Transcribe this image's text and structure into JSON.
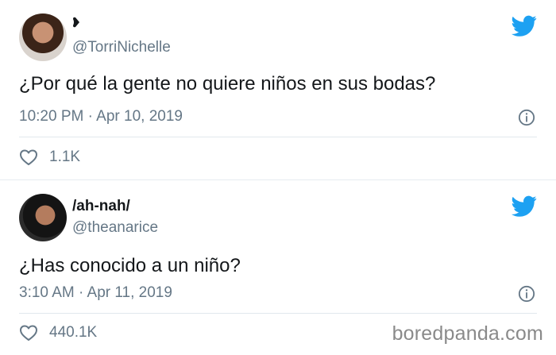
{
  "tweets": [
    {
      "name": "",
      "handle": "@TorriNichelle",
      "text": "¿Por qué la gente no quiere niños en sus bodas?",
      "timestamp": "10:20 PM · Apr 10, 2019",
      "likes": "1.1K",
      "icons": {
        "brand": "twitter-bird-icon",
        "info": "info-icon",
        "like": "heart-icon"
      }
    },
    {
      "name": "/ah-nah/",
      "handle": "@theanarice",
      "text": "¿Has conocido a un niño?",
      "timestamp": "3:10 AM · Apr 11, 2019",
      "likes": "440.1K",
      "icons": {
        "brand": "twitter-bird-icon",
        "info": "info-icon",
        "like": "heart-icon"
      }
    }
  ],
  "watermark": "boredpanda.com",
  "colors": {
    "twitter_blue": "#1da1f2",
    "secondary_text": "#657786",
    "primary_text": "#14171a"
  }
}
